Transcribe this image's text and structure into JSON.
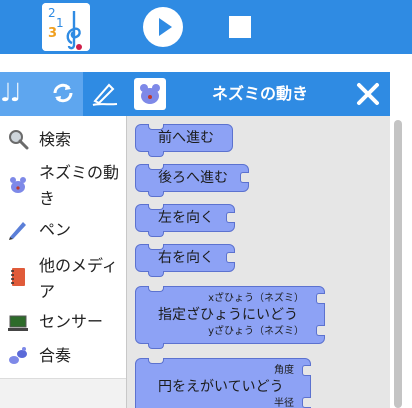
{
  "toolbar": {
    "app_icon": "music-numbers-icon",
    "app_icon_digits": [
      "2",
      "1",
      "3"
    ],
    "play": "play-icon",
    "stop": "stop-icon"
  },
  "tabs": {
    "blocks_tab": "music-notes-icon",
    "blocks_notes": "♩♩",
    "sync": "sync-icon",
    "pen": "pen-icon"
  },
  "panel": {
    "title": "ネズミの動き",
    "icon": "mouse-icon",
    "close": "close-icon"
  },
  "categories": [
    {
      "label": "検索",
      "icon": "magnifier-icon"
    },
    {
      "label": "ネズミの動き",
      "icon": "mouse-icon"
    },
    {
      "label": "ペン",
      "icon": "pencil-icon"
    },
    {
      "label": "他のメディア",
      "icon": "notebook-icon"
    },
    {
      "label": "センサー",
      "icon": "laptop-icon"
    },
    {
      "label": "合奏",
      "icon": "ensemble-icon"
    }
  ],
  "blocks": [
    {
      "label": "前へ進む"
    },
    {
      "label": "後ろへ進む"
    },
    {
      "label": "左を向く"
    },
    {
      "label": "右を向く"
    },
    {
      "label": "指定ざひょうにいどう",
      "param1": "xざひょう（ネズミ）",
      "param2": "yざひょう（ネズミ）"
    },
    {
      "label": "円をえがいていどう",
      "param1": "角度",
      "param2": "半径"
    }
  ],
  "colors": {
    "accent": "#2f8be3",
    "accent_light": "#5ea6ef",
    "block_fill": "#8da2f5",
    "block_border": "#5c72cf",
    "palette_bg": "#e6e6e6"
  }
}
